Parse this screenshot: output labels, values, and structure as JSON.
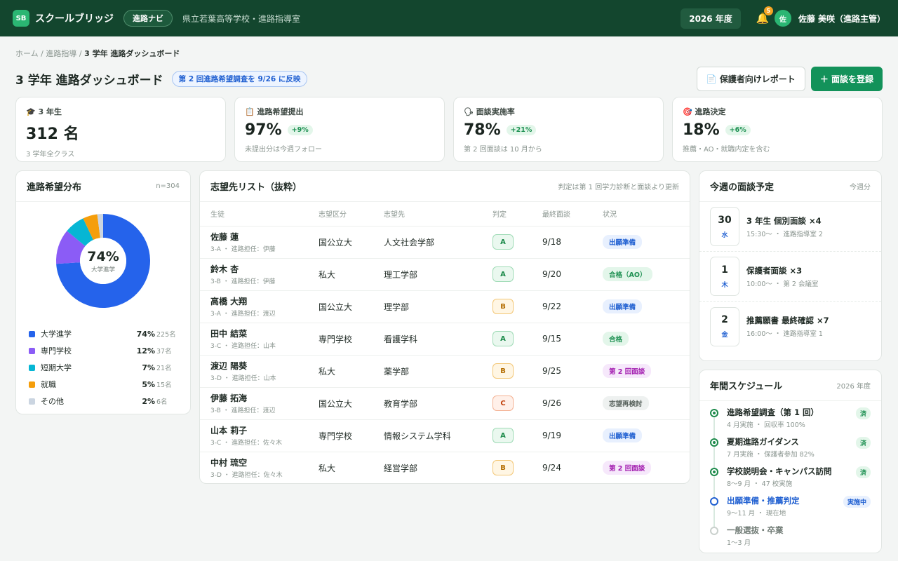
{
  "header": {
    "logo": "SB",
    "brand": "スクールブリッジ",
    "nav_pill": "進路ナビ",
    "school": "県立若葉高等学校・進路指導室",
    "year": "2026 年度",
    "notif_count": "5",
    "avatar": "佐",
    "user": "佐藤 美咲（進路主管）"
  },
  "breadcrumb": {
    "home": "ホーム",
    "sep": "/",
    "section": "進路指導",
    "current": "3 学年 進路ダッシュボード"
  },
  "page": {
    "title": "3 学年 進路ダッシュボード",
    "notice": "第 2 回進路希望調査を 9/26 に反映",
    "report_button": "📄 保護者向けレポート",
    "add_button": "＋ 面談を登録"
  },
  "stats": [
    {
      "label": "🎓 3 年生",
      "value": "312 名",
      "delta": "",
      "sub": "3 学年全クラス"
    },
    {
      "label": "📋 進路希望提出",
      "value": "97%",
      "delta": "+9%",
      "sub": "未提出分は今週フォロー"
    },
    {
      "label": "🗣 面談実施率",
      "value": "78%",
      "delta": "+21%",
      "sub": "第 2 回面談は 10 月から"
    },
    {
      "label": "🎯 進路決定",
      "value": "18%",
      "delta": "+6%",
      "sub": "推薦・AO・就職内定を含む"
    }
  ],
  "distribution": {
    "title": "進路希望分布",
    "meta": "n=304",
    "center_value": "74%",
    "center_caption": "大学進学",
    "items": [
      {
        "name": "大学進学",
        "pct": "74%",
        "count": "225名",
        "value": 74,
        "color": "#2563eb"
      },
      {
        "name": "専門学校",
        "pct": "12%",
        "count": "37名",
        "value": 12,
        "color": "#8b5cf6"
      },
      {
        "name": "短期大学",
        "pct": "7%",
        "count": "21名",
        "value": 7,
        "color": "#06b6d4"
      },
      {
        "name": "就職",
        "pct": "5%",
        "count": "15名",
        "value": 5,
        "color": "#f59e0b"
      },
      {
        "name": "その他",
        "pct": "2%",
        "count": "6名",
        "value": 2,
        "color": "#cbd5e1"
      }
    ]
  },
  "table": {
    "title": "志望先リスト（抜粋）",
    "meta": "判定は第 1 回学力診断と面談より更新",
    "columns": [
      "生徒",
      "志望区分",
      "志望先",
      "判定",
      "最終面談",
      "状況"
    ],
    "rows": [
      {
        "name": "佐藤 蓮",
        "cls": "3-A ・ 進路担任：伊藤",
        "type": "国公立大",
        "target": "人文社会学部",
        "grade": "A",
        "last": "9/18",
        "status": "出願準備",
        "st": "blue"
      },
      {
        "name": "鈴木 杏",
        "cls": "3-B ・ 進路担任：伊藤",
        "type": "私大",
        "target": "理工学部",
        "grade": "A",
        "last": "9/20",
        "status": "合格（AO）",
        "st": "green"
      },
      {
        "name": "高橋 大翔",
        "cls": "3-A ・ 進路担任：渡辺",
        "type": "国公立大",
        "target": "理学部",
        "grade": "B",
        "last": "9/22",
        "status": "出願準備",
        "st": "blue"
      },
      {
        "name": "田中 結菜",
        "cls": "3-C ・ 進路担任：山本",
        "type": "専門学校",
        "target": "看護学科",
        "grade": "A",
        "last": "9/15",
        "status": "合格",
        "st": "green"
      },
      {
        "name": "渡辺 陽葵",
        "cls": "3-D ・ 進路担任：山本",
        "type": "私大",
        "target": "薬学部",
        "grade": "B",
        "last": "9/25",
        "status": "第 2 回面談",
        "st": "purple"
      },
      {
        "name": "伊藤 拓海",
        "cls": "3-B ・ 進路担任：渡辺",
        "type": "国公立大",
        "target": "教育学部",
        "grade": "C",
        "last": "9/26",
        "status": "志望再検討",
        "st": "gray"
      },
      {
        "name": "山本 莉子",
        "cls": "3-C ・ 進路担任：佐々木",
        "type": "専門学校",
        "target": "情報システム学科",
        "grade": "A",
        "last": "9/19",
        "status": "出願準備",
        "st": "blue"
      },
      {
        "name": "中村 琉空",
        "cls": "3-D ・ 進路担任：佐々木",
        "type": "私大",
        "target": "経営学部",
        "grade": "B",
        "last": "9/24",
        "status": "第 2 回面談",
        "st": "purple"
      }
    ]
  },
  "meetings": {
    "title": "今週の面談予定",
    "meta": "今週分",
    "items": [
      {
        "date": "30",
        "day": "水",
        "title": "3 年生 個別面談 ×4",
        "sub": "15:30〜 ・ 進路指導室 2"
      },
      {
        "date": "1",
        "day": "木",
        "title": "保護者面談 ×3",
        "sub": "10:00〜 ・ 第 2 会議室"
      },
      {
        "date": "2",
        "day": "金",
        "title": "推薦願書 最終確認 ×7",
        "sub": "16:00〜 ・ 進路指導室 1"
      }
    ]
  },
  "schedule": {
    "title": "年間スケジュール",
    "meta": "2026 年度",
    "items": [
      {
        "title": "進路希望調査（第 1 回）",
        "sub": "4 月実施 ・ 回収率 100%",
        "state": "done",
        "badge": "済"
      },
      {
        "title": "夏期進路ガイダンス",
        "sub": "7 月実施 ・ 保護者参加 82%",
        "state": "done",
        "badge": "済"
      },
      {
        "title": "学校説明会・キャンパス訪問",
        "sub": "8〜9 月 ・ 47 校実施",
        "state": "done",
        "badge": "済"
      },
      {
        "title": "出願準備・推薦判定",
        "sub": "9〜11 月 ・ 現在地",
        "state": "current",
        "badge": "実施中"
      },
      {
        "title": "一般選抜・卒業",
        "sub": "1〜3 月",
        "state": "future",
        "badge": ""
      }
    ]
  }
}
